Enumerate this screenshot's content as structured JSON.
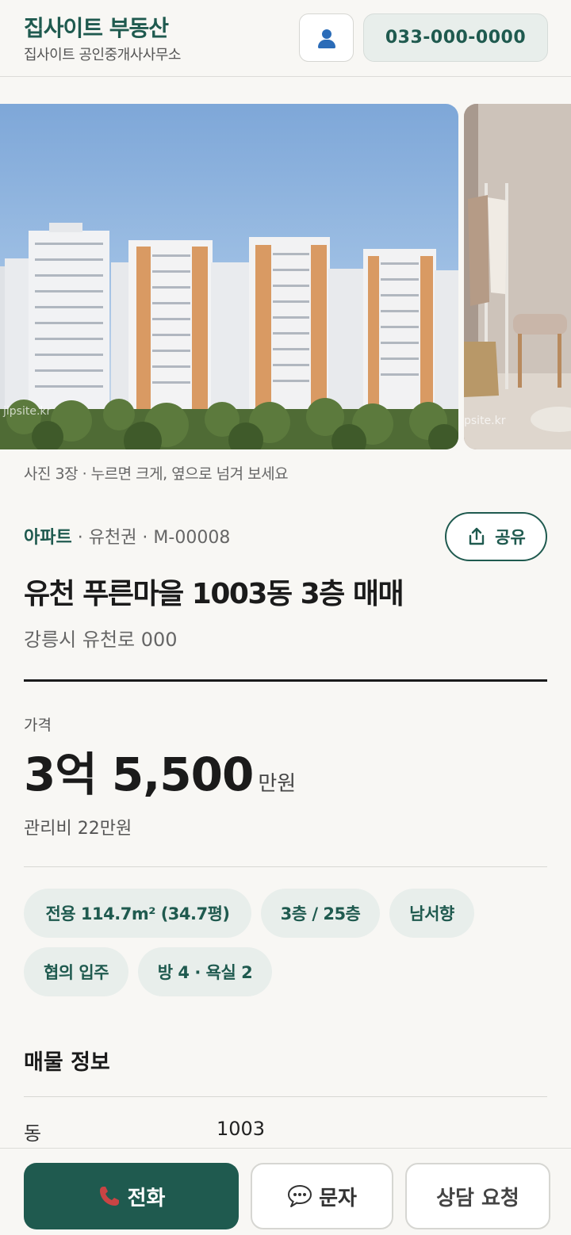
{
  "header": {
    "brand_title": "집사이트 부동산",
    "brand_subtitle": "집사이트 공인중개사사무소",
    "phone": "033-000-0000",
    "user_icon": "user-icon"
  },
  "gallery": {
    "caption": "사진 3장 · 누르면 크게, 옆으로 넘겨 보세요",
    "watermark": "jipsite.kr"
  },
  "listing": {
    "type": "아파트",
    "meta_rest": " · 유천권 · M-00008",
    "title": "유천 푸른마을 1003동 3층 매매",
    "address": "강릉시 유천로 000",
    "share_label": "공유",
    "price_label": "가격",
    "price": "3억 5,500",
    "price_unit": "만원",
    "maintenance_fee": "관리비 22만원"
  },
  "chips": [
    "전용 114.7m² (34.7평)",
    "3층 / 25층",
    "남서향",
    "협의 입주",
    "방 4 · 욕실 2"
  ],
  "details": {
    "section_title": "매물 정보",
    "rows": [
      {
        "label": "동",
        "value": "1003"
      }
    ]
  },
  "actions": {
    "call": "전화",
    "sms": "문자",
    "consult": "상담 요청"
  },
  "colors": {
    "brand": "#1f5a4f",
    "chip_bg": "#e8eeeb",
    "page_bg": "#f8f7f4"
  }
}
